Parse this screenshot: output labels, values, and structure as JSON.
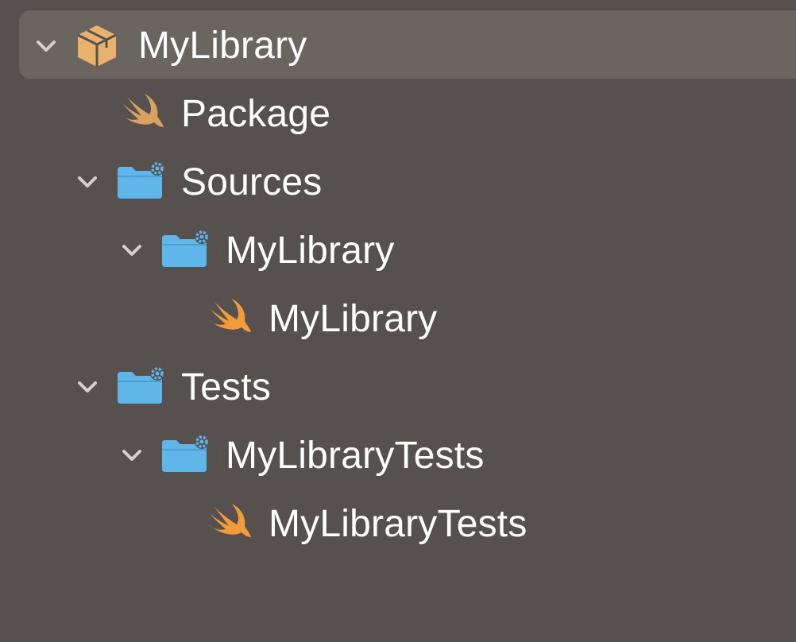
{
  "tree": {
    "root": {
      "label": "MyLibrary",
      "icon": "package-icon",
      "expanded": true,
      "selected": true
    },
    "package_file": {
      "label": "Package",
      "icon": "swift-icon"
    },
    "sources": {
      "label": "Sources",
      "icon": "folder-gear-icon",
      "expanded": true,
      "child_folder": {
        "label": "MyLibrary",
        "icon": "folder-gear-icon",
        "expanded": true,
        "file": {
          "label": "MyLibrary",
          "icon": "swift-icon"
        }
      }
    },
    "tests": {
      "label": "Tests",
      "icon": "folder-gear-icon",
      "expanded": true,
      "child_folder": {
        "label": "MyLibraryTests",
        "icon": "folder-gear-icon",
        "expanded": true,
        "file": {
          "label": "MyLibraryTests",
          "icon": "swift-icon"
        }
      }
    }
  },
  "colors": {
    "background": "#56514e",
    "selection": "#6b6560",
    "folder": "#5fb6e8",
    "swift_muted": "#d9a061",
    "swift": "#f39a3a",
    "package": "#e8b26d",
    "chevron": "#d5d0cb",
    "text": "#ffffff"
  }
}
